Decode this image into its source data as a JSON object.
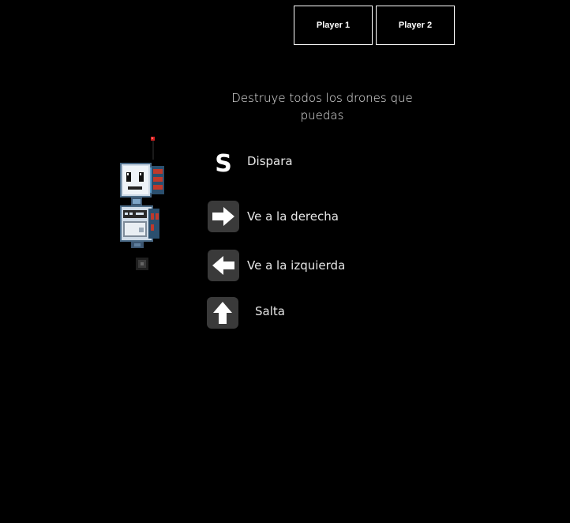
{
  "players": {
    "player1_label": "Player 1",
    "player2_label": "Player 2"
  },
  "instructions": {
    "objective": "Destruye todos los drones que puedas",
    "controls": [
      {
        "key": "S",
        "icon": "s-key",
        "label": "Dispara"
      },
      {
        "key": "→",
        "icon": "arrow-right-icon",
        "label": "Ve a la derecha"
      },
      {
        "key": "←",
        "icon": "arrow-left-icon",
        "label": "Ve a la izquierda"
      },
      {
        "key": "↑",
        "icon": "arrow-up-icon",
        "label": "Salta"
      }
    ]
  },
  "colors": {
    "background": "#000000",
    "key_background": "#3a3a3a",
    "text": "#e6e6e6",
    "robot_red": "#c0392b"
  }
}
